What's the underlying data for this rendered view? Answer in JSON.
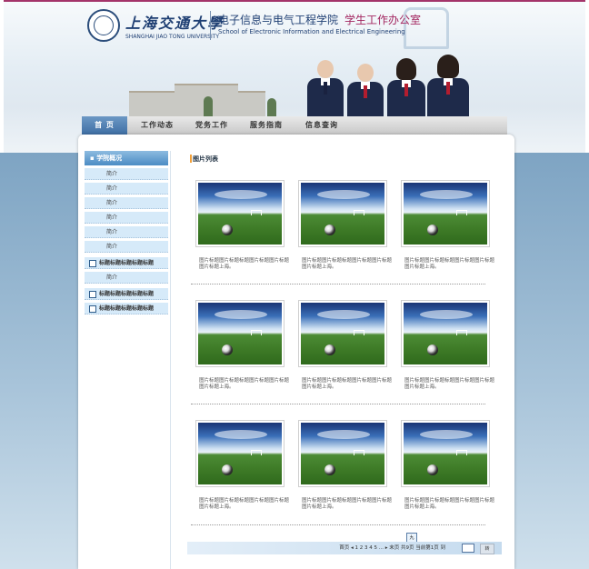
{
  "header": {
    "university_cn": "上海交通大學",
    "university_en": "SHANGHAI JIAO TONG UNIVERSITY",
    "school_cn": "电子信息与电气工程学院",
    "office_cn": "学生工作办公室",
    "school_en": "School of Electronic Information and Electrical Engineering"
  },
  "nav": {
    "items": [
      "首 页",
      "工作动态",
      "党务工作",
      "服务指南",
      "信息查询"
    ]
  },
  "sidebar": {
    "heading": "学院概况",
    "items": [
      {
        "label": "简介",
        "type": "sub"
      },
      {
        "label": "简介",
        "type": "sub"
      },
      {
        "label": "简介",
        "type": "sub"
      },
      {
        "label": "简介",
        "type": "sub"
      },
      {
        "label": "简介",
        "type": "sub"
      },
      {
        "label": "简介",
        "type": "sub"
      },
      {
        "label": "标题标题标题标题标题",
        "type": "cat"
      },
      {
        "label": "简介",
        "type": "sub"
      },
      {
        "label": "标题标题标题标题标题",
        "type": "cat"
      },
      {
        "label": "标题标题标题标题标题",
        "type": "cat"
      }
    ]
  },
  "main": {
    "title": "图片列表",
    "photos": [
      {
        "caption": "图片标题图片标题标题图片标题图片标题图片标题上海。"
      },
      {
        "caption": "图片标题图片标题标题图片标题图片标题图片标题上海。"
      },
      {
        "caption": "图片标题图片标题标题图片标题图片标题图片标题上海。"
      },
      {
        "caption": "图片标题图片标题标题图片标题图片标题图片标题上海。"
      },
      {
        "caption": "图片标题图片标题标题图片标题图片标题图片标题上海。"
      },
      {
        "caption": "图片标题图片标题标题图片标题图片标题图片标题上海。"
      },
      {
        "caption": "图片标题图片标题标题图片标题图片标题图片标题上海。"
      },
      {
        "caption": "图片标题图片标题标题图片标题图片标题图片标题上海。"
      },
      {
        "caption": "图片标题图片标题标题图片标题图片标题图片标题上海。"
      }
    ]
  },
  "pager": {
    "text": "首页 ◂ 1 2 3 4 5 ... ▸ 末页 共9页 当前第1页 到",
    "hover_label": "九",
    "go_label": "转"
  },
  "colors": {
    "accent": "#3f6fa4",
    "office_magenta": "#a2255f",
    "title_marker": "#f2a13a"
  }
}
